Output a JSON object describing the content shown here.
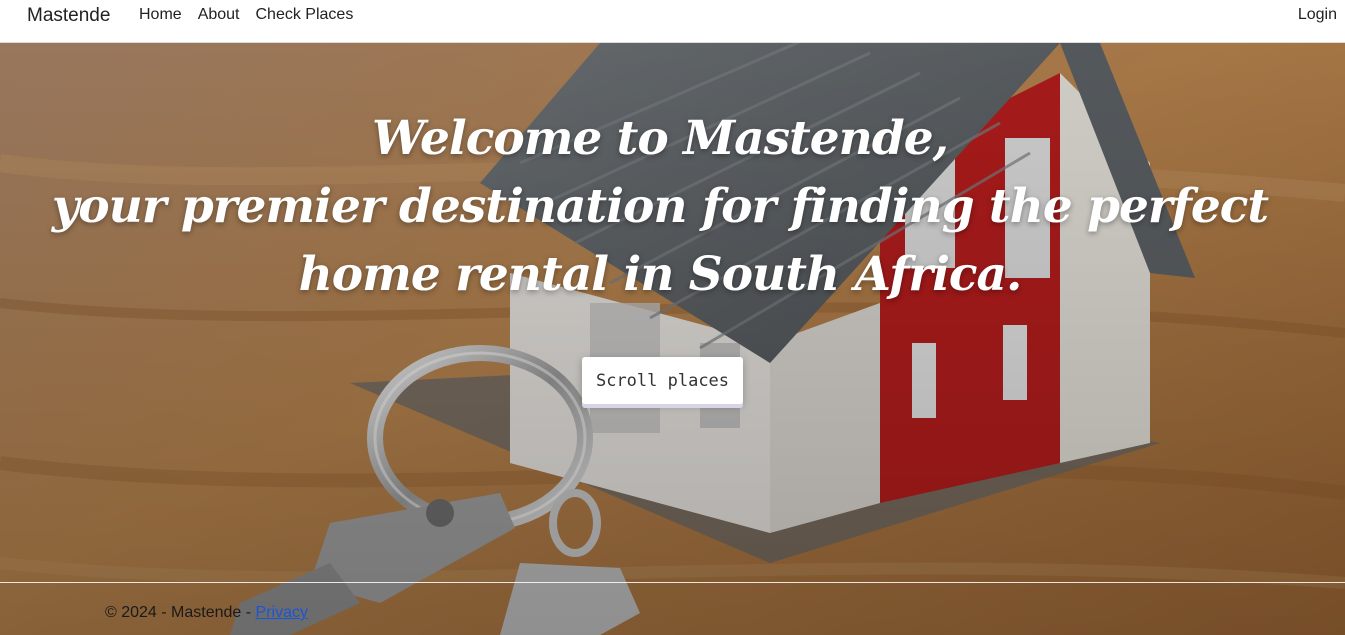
{
  "navbar": {
    "brand": "Mastende",
    "links": [
      "Home",
      "About",
      "Check Places"
    ],
    "login": "Login"
  },
  "hero": {
    "title_lines": [
      "Welcome to Mastende,",
      "your premier destination for finding the perfect",
      "home rental in South Africa."
    ],
    "button_label": "Scroll places"
  },
  "footer": {
    "text": "© 2024 - Mastende - ",
    "privacy_label": "Privacy"
  },
  "colors": {
    "navbar_bg": "#ffffff",
    "hero_text": "#ffffff",
    "link": "#1a55d6"
  },
  "icons": {
    "hero_image": "house-with-keys-illustration"
  }
}
